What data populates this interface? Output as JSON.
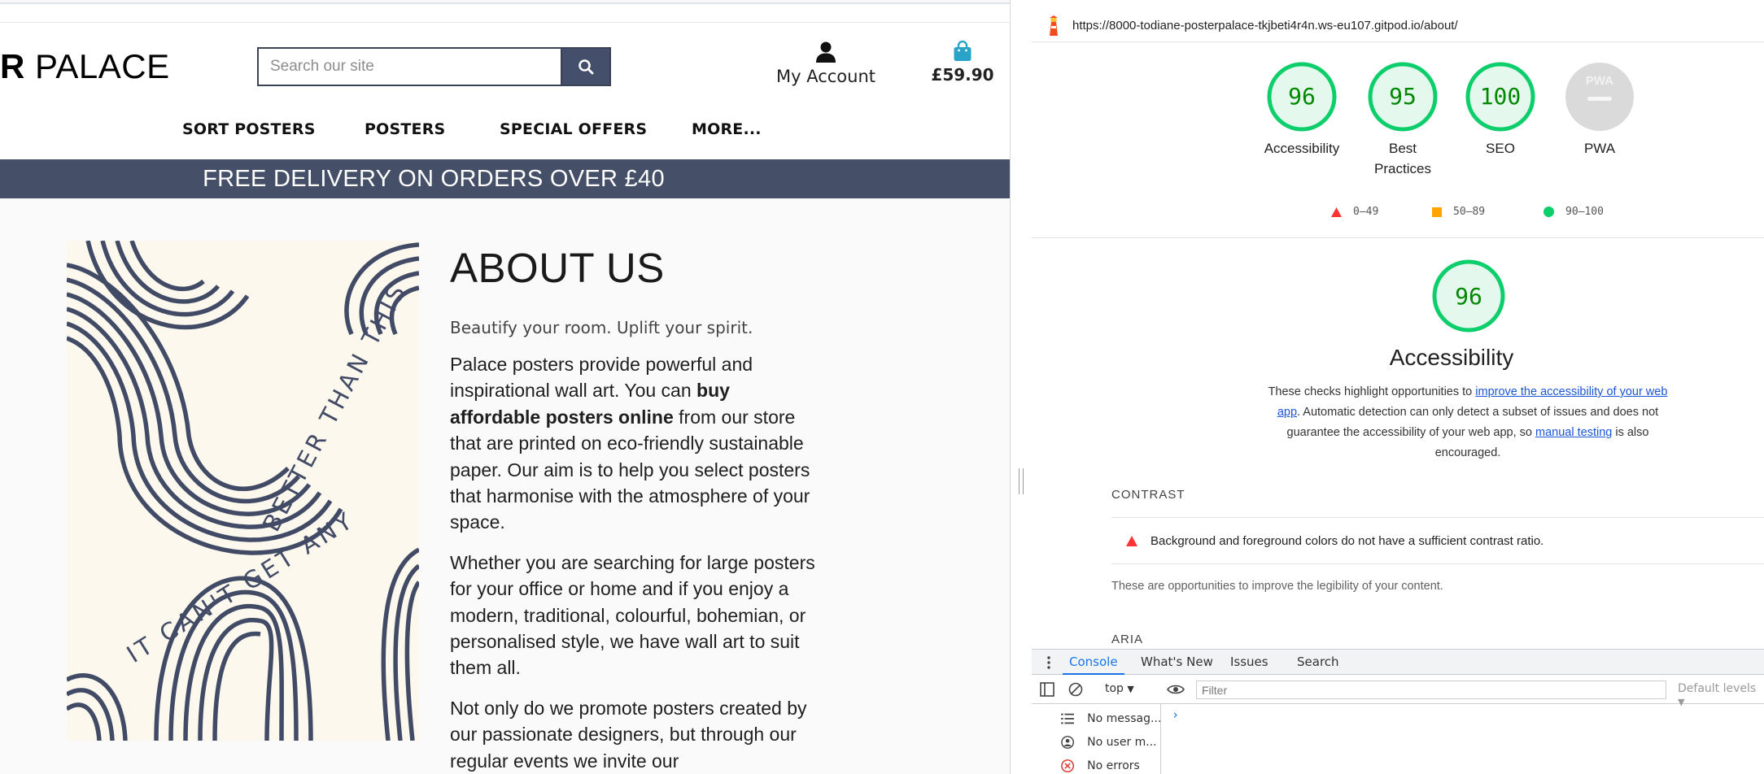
{
  "site": {
    "brand": "R PALACE",
    "search": {
      "placeholder": "Search our site"
    },
    "account_label": "My Account",
    "bag_total": "£59.90",
    "nav": [
      "SORT POSTERS",
      "POSTERS",
      "SPECIAL OFFERS",
      "MORE..."
    ],
    "banner": "FREE DELIVERY ON ORDERS OVER £40",
    "poster_text": [
      "IT CAN'T GET ANY",
      "BETTER THAN THIS"
    ],
    "about": {
      "title": "ABOUT US",
      "lead": "Beautify your room. Uplift your spirit.",
      "p1_a": "Palace posters provide powerful and inspirational wall art. You can ",
      "p1_bold": "buy affordable posters online",
      "p1_b": " from our store that are printed on eco-friendly sustainable paper. Our aim is to help you select posters that harmonise with the atmosphere of your space.",
      "p2": "Whether you are searching for large posters for your office or home and if you enjoy a modern, traditional, colourful, bohemian, or personalised style, we have wall art to suit them all.",
      "p3": "Not only do we promote posters created by our passionate designers, but through our regular events we invite our"
    }
  },
  "devtools": {
    "url": "https://8000-todiane-posterpalace-tkjbeti4r4n.ws-eu107.gitpod.io/about/",
    "scores": [
      {
        "label": "Accessibility",
        "value": 96
      },
      {
        "label": "Best Practices",
        "value": 95
      },
      {
        "label": "SEO",
        "value": 100
      },
      {
        "label": "PWA",
        "value": null,
        "badge": "PWA"
      }
    ],
    "legend": [
      "0–49",
      "50–89",
      "90–100"
    ],
    "colors": {
      "pass": "#0cce6b",
      "pass_text": "#008800",
      "pass_bg": "#e5f8ee",
      "average": "#ffa400",
      "fail": "#ff3333",
      "na": "#cccccc"
    },
    "category": {
      "score": 96,
      "title": "Accessibility",
      "desc_a": "These checks highlight opportunities to ",
      "desc_link1": "improve the accessibility of your web app",
      "desc_b": ". Automatic detection can only detect a subset of issues and does not guarantee the accessibility of your web app, so ",
      "desc_link2": "manual testing",
      "desc_c": " is also encouraged."
    },
    "group_contrast": "CONTRAST",
    "audit_contrast": "Background and foreground colors do not have a sufficient contrast ratio.",
    "contrast_note": "These are opportunities to improve the legibility of your content.",
    "group_aria": "ARIA",
    "drawer_tabs": [
      "Console",
      "What's New",
      "Issues",
      "Search"
    ],
    "context": "top",
    "filter_placeholder": "Filter",
    "levels": "Default levels",
    "sidebar": [
      "No messag...",
      "No user m...",
      "No errors"
    ]
  }
}
